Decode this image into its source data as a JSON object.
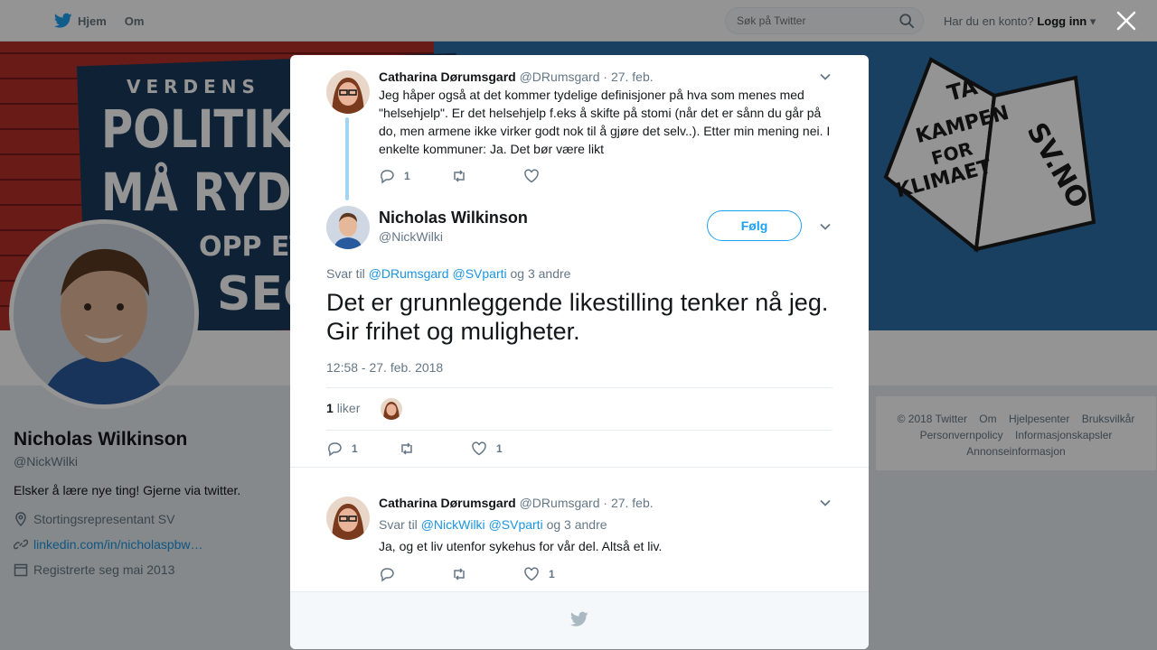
{
  "topbar": {
    "nav": [
      {
        "label": "Hjem",
        "icon": "twitter-bird-icon"
      },
      {
        "label": "Om"
      }
    ],
    "search_placeholder": "Søk på Twitter",
    "login_prompt": "Har du en konto?",
    "login_label": "Logg inn"
  },
  "banner": {
    "left_small": "VERDENS",
    "left_line1": "POLITIKERE",
    "left_line2": "MÅ RYDDE",
    "left_line3": "OPP ETTER",
    "left_line4": "SEG",
    "right_line1": "TA",
    "right_line2": "KAMPEN",
    "right_line3": "FOR",
    "right_line4": "KLIMAET",
    "right_site": "SV.NO"
  },
  "profile": {
    "name": "Nicholas Wilkinson",
    "handle": "@NickWilki",
    "bio": "Elsker å lære nye ting! Gjerne via twitter.",
    "location": "Stortingsrepresentant SV",
    "link": "linkedin.com/in/nicholaspbw…",
    "joined": "Registrerte seg mai 2013"
  },
  "footer_links": [
    "© 2018 Twitter",
    "Om",
    "Hjelpesenter",
    "Bruksvilkår",
    "Personvernpolicy",
    "Informasjonskapsler",
    "Annonseinformasjon"
  ],
  "modal": {
    "parent_tweet": {
      "name": "Catharina Dørumsgard",
      "handle": "@DRumsgard",
      "date": "· 27. feb.",
      "text": "Jeg håper også at det kommer  tydelige definisjoner på hva som menes med \"helsehjelp\". Er det helsehjelp f.eks å skifte på stomi (når det er sånn du går på do, men armene ikke virker godt nok til å gjøre det selv..). Etter min mening nei. I enkelte kommuner: Ja. Det bør være likt",
      "replies": "1",
      "retweets": "",
      "likes": ""
    },
    "main_tweet": {
      "name": "Nicholas Wilkinson",
      "handle": "@NickWilki",
      "follow_label": "Følg",
      "reply_prefix": "Svar til",
      "reply_mention1": "@DRumsgard",
      "reply_mention2": "@SVparti",
      "reply_suffix": "og 3 andre",
      "text": "Det er grunnleggende likestilling tenker nå jeg. Gir frihet og muligheter.",
      "timestamp": "12:58 - 27. feb. 2018",
      "likes_count": "1",
      "likes_label": "liker",
      "replies": "1",
      "retweets": "",
      "likes": "1"
    },
    "reply_tweet": {
      "name": "Catharina Dørumsgard",
      "handle": "@DRumsgard",
      "date": "· 27. feb.",
      "reply_prefix": "Svar til",
      "reply_mention1": "@NickWilki",
      "reply_mention2": "@SVparti",
      "reply_suffix": "og 3 andre",
      "text": "Ja, og et liv utenfor sykehus for vår del. Altså et liv.",
      "replies": "",
      "retweets": "",
      "likes": "1"
    }
  },
  "colors": {
    "accent": "#1da1f2",
    "link": "#1b95e0",
    "muted": "#657786",
    "thread_line": "#a3d4f5"
  }
}
